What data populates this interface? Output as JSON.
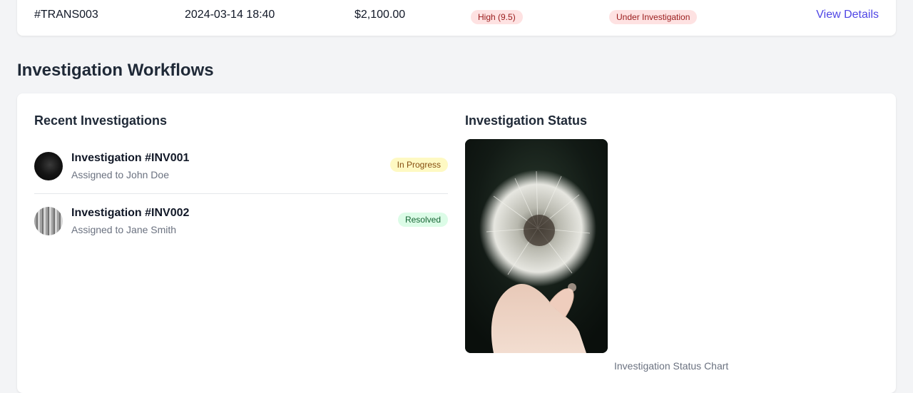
{
  "transaction_row": {
    "id": "#TRANS003",
    "datetime": "2024-03-14 18:40",
    "amount": "$2,100.00",
    "risk": "High (9.5)",
    "status": "Under Investigation",
    "action": "View Details"
  },
  "section": {
    "title": "Investigation Workflows"
  },
  "recent": {
    "title": "Recent Investigations",
    "items": [
      {
        "name": "Investigation #INV001",
        "assignee": "Assigned to John Doe",
        "status": "In Progress"
      },
      {
        "name": "Investigation #INV002",
        "assignee": "Assigned to Jane Smith",
        "status": "Resolved"
      }
    ]
  },
  "status_panel": {
    "title": "Investigation Status",
    "caption": "Investigation Status Chart"
  },
  "colors": {
    "link": "#4f46e5",
    "badge_red_bg": "#fee2e2",
    "badge_red_text": "#991b1b",
    "badge_yellow_bg": "#fef9c3",
    "badge_yellow_text": "#854d0e",
    "badge_green_bg": "#dcfce7",
    "badge_green_text": "#166534"
  },
  "icons": {
    "avatar_1": "avatar-dark-photo",
    "avatar_2": "avatar-grayscale-photo",
    "status_image": "dandelion-photo"
  }
}
